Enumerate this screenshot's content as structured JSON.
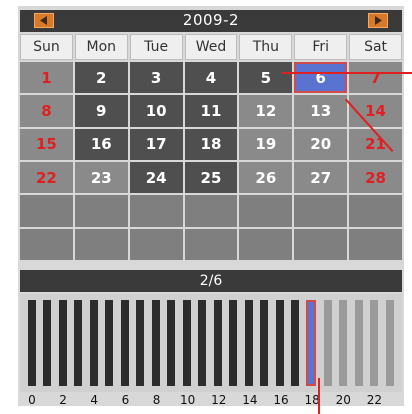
{
  "calendar": {
    "month_label": "2009-2",
    "prev_icon": "triangle-left-icon",
    "next_icon": "triangle-right-icon",
    "weekdays": [
      "Sun",
      "Mon",
      "Tue",
      "Wed",
      "Thu",
      "Fri",
      "Sat"
    ],
    "weeks": [
      [
        1,
        2,
        3,
        4,
        5,
        6,
        7
      ],
      [
        8,
        9,
        10,
        11,
        12,
        13,
        14
      ],
      [
        15,
        16,
        17,
        18,
        19,
        20,
        21
      ],
      [
        22,
        23,
        24,
        25,
        26,
        27,
        28
      ],
      [
        null,
        null,
        null,
        null,
        null,
        null,
        null
      ],
      [
        null,
        null,
        null,
        null,
        null,
        null,
        null
      ]
    ],
    "selected_day": 6,
    "days_with_recordings": [
      2,
      3,
      4,
      5,
      6,
      9,
      10,
      11,
      16,
      17,
      18,
      24,
      25
    ]
  },
  "timebar": {
    "date_label": "2/6",
    "hour_ticks": [
      "0",
      "2",
      "4",
      "6",
      "8",
      "10",
      "12",
      "14",
      "16",
      "18",
      "20",
      "22"
    ],
    "hours_recorded": [
      0,
      1,
      2,
      3,
      4,
      5,
      6,
      7,
      8,
      9,
      10,
      11,
      12,
      13,
      14,
      15,
      16,
      17
    ],
    "current_hour": 18
  },
  "colors": {
    "header_bg": "#3a3a3a",
    "nav_button": "#d87a2a",
    "weekend_text": "#e02020",
    "selected_fill": "#5a72d0",
    "selected_border": "#d04a4a"
  }
}
